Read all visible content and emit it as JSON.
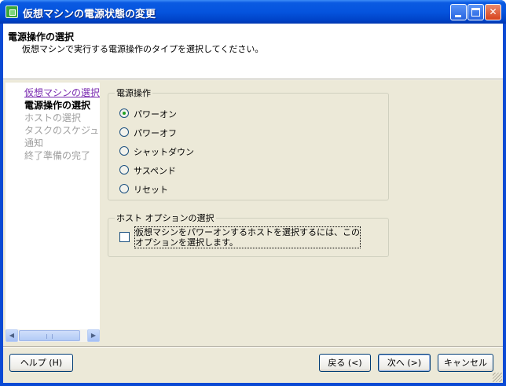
{
  "window": {
    "title": "仮想マシンの電源状態の変更"
  },
  "header": {
    "title": "電源操作の選択",
    "subtitle": "仮想マシンで実行する電源操作のタイプを選択してください。"
  },
  "nav": {
    "items": [
      {
        "label": "仮想マシンの選択",
        "state": "link"
      },
      {
        "label": "電源操作の選択",
        "state": "current"
      },
      {
        "label": "ホストの選択",
        "state": "disabled"
      },
      {
        "label": "タスクのスケジュール設",
        "state": "disabled"
      },
      {
        "label": "通知",
        "state": "disabled"
      },
      {
        "label": "終了準備の完了",
        "state": "disabled"
      }
    ]
  },
  "power_group": {
    "legend": "電源操作",
    "options": [
      {
        "label": "パワーオン",
        "selected": true
      },
      {
        "label": "パワーオフ",
        "selected": false
      },
      {
        "label": "シャットダウン",
        "selected": false
      },
      {
        "label": "サスペンド",
        "selected": false
      },
      {
        "label": "リセット",
        "selected": false
      }
    ]
  },
  "host_group": {
    "legend": "ホスト オプションの選択",
    "checkbox_label": "仮想マシンをパワーオンするホストを選択するには、このオプションを選択します。",
    "checked": false
  },
  "buttons": {
    "help": "ヘルプ (H)",
    "back": "戻る (<)",
    "next": "次へ (>)",
    "cancel": "キャンセル"
  }
}
